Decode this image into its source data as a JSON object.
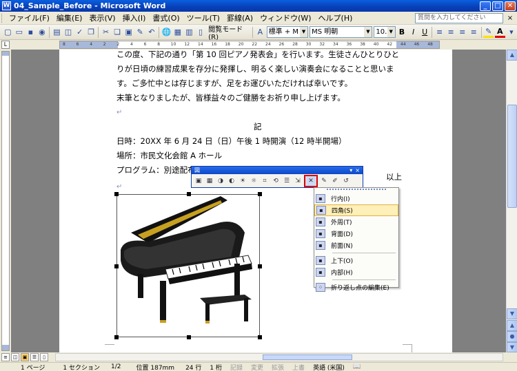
{
  "window": {
    "title": "04_Sample_Before - Microsoft Word",
    "minimize": "_",
    "maximize": "□",
    "close": "✕"
  },
  "menubar": {
    "items": [
      "ファイル(F)",
      "編集(E)",
      "表示(V)",
      "挿入(I)",
      "書式(O)",
      "ツール(T)",
      "罫線(A)",
      "ウィンドウ(W)",
      "ヘルプ(H)"
    ],
    "search_placeholder": "質問を入力してください",
    "close_doc": "×"
  },
  "toolbar": {
    "reading_mode": "閲覧モード(R)",
    "style": "標準 + M",
    "font": "MS 明朝",
    "size": "10.5",
    "bold": "B",
    "italic": "I",
    "underline": "U",
    "font_color": "A",
    "highlight_color": "#FFE000",
    "font_color_value": "#E00000"
  },
  "ruler": {
    "corner": "L",
    "ticks": [
      "8",
      "6",
      "4",
      "2",
      "2",
      "4",
      "6",
      "8",
      "10",
      "12",
      "14",
      "16",
      "18",
      "20",
      "22",
      "24",
      "26",
      "28",
      "30",
      "32",
      "34",
      "36",
      "38",
      "40",
      "42",
      "44",
      "46",
      "48"
    ]
  },
  "document": {
    "lines": [
      "この度、下記の通り「第 10 回ピアノ発表会」を行います。生徒さんひとりひと",
      "りが日頃の練習成果を存分に発揮し、明るく楽しい演奏会になることと思いま",
      "す。ご多忙中とは存じますが、足をお運びいただければ幸いです。",
      "末筆となりましたが、皆様益々のご健勝をお祈り申し上げます。",
      "",
      "",
      "日時：20XX 年 6 月 24 日（日）午後 1 時開演（12 時半開場）",
      "場所：市民文化会館 A ホール",
      "プログラム：別途配布の演奏プログラム参照"
    ],
    "ki": "記",
    "ijou": "以上",
    "para_mark": "↵"
  },
  "picture_toolbar": {
    "title": "図",
    "close": "×"
  },
  "wrap_menu": {
    "items": [
      {
        "label": "行内(I)",
        "icon": "inline-icon"
      },
      {
        "label": "四角(S)",
        "icon": "square-wrap-icon",
        "highlighted": true
      },
      {
        "label": "外周(T)",
        "icon": "tight-wrap-icon"
      },
      {
        "label": "背面(D)",
        "icon": "behind-text-icon"
      },
      {
        "label": "前面(N)",
        "icon": "in-front-icon"
      },
      {
        "label": "上下(O)",
        "icon": "top-bottom-icon"
      },
      {
        "label": "内部(H)",
        "icon": "through-icon"
      },
      {
        "label": "折り返し点の編集(E)",
        "icon": "edit-wrap-points-icon"
      }
    ]
  },
  "statusbar": {
    "page": "1 ページ",
    "section": "1 セクション",
    "pages": "1/2",
    "position": "位置 187mm",
    "line": "24 行",
    "column": "1 桁",
    "rec": "記録",
    "trk": "変更",
    "ext": "拡張",
    "ovr": "上書",
    "language": "英語 (米国)"
  }
}
